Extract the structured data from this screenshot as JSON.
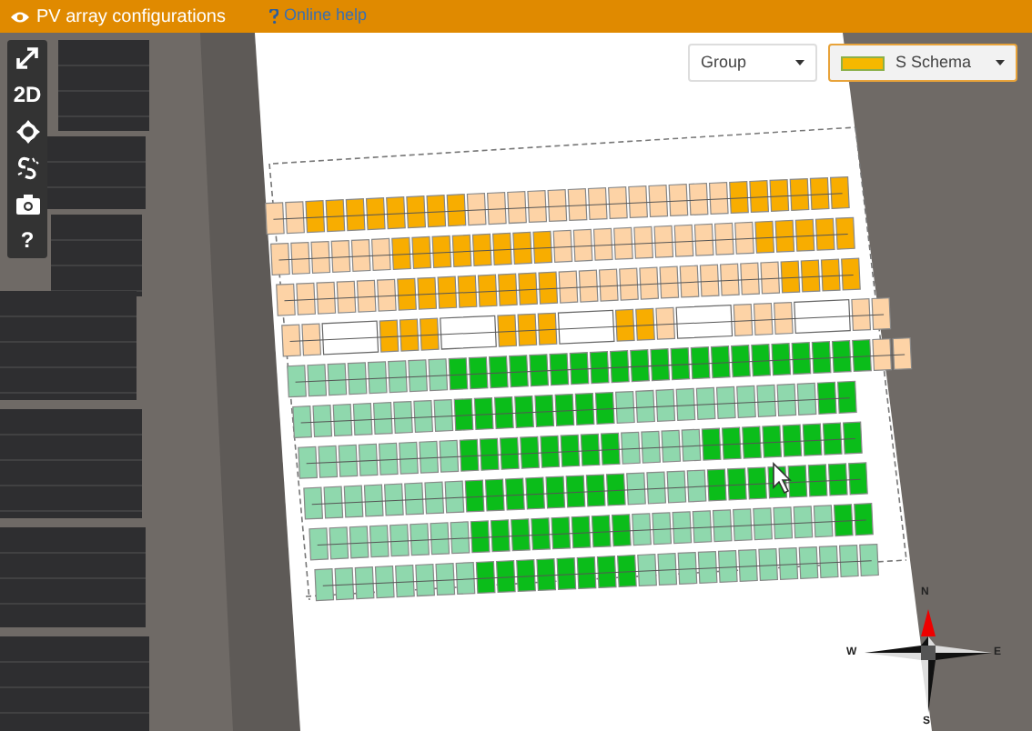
{
  "header": {
    "title": "PV array configurations",
    "help_link": "Online help"
  },
  "toolbar": [
    {
      "kind": "expand"
    },
    {
      "kind": "text",
      "label": "2D"
    },
    {
      "kind": "crosshair"
    },
    {
      "kind": "unlink"
    },
    {
      "kind": "camera"
    },
    {
      "kind": "text",
      "label": "?"
    }
  ],
  "dropdowns": [
    {
      "label": "Group",
      "selected": false,
      "swatch": false
    },
    {
      "label": "S Schema",
      "selected": true,
      "swatch": true
    }
  ],
  "compass": {
    "north": "N",
    "east": "E",
    "south": "S",
    "west": "W"
  }
}
